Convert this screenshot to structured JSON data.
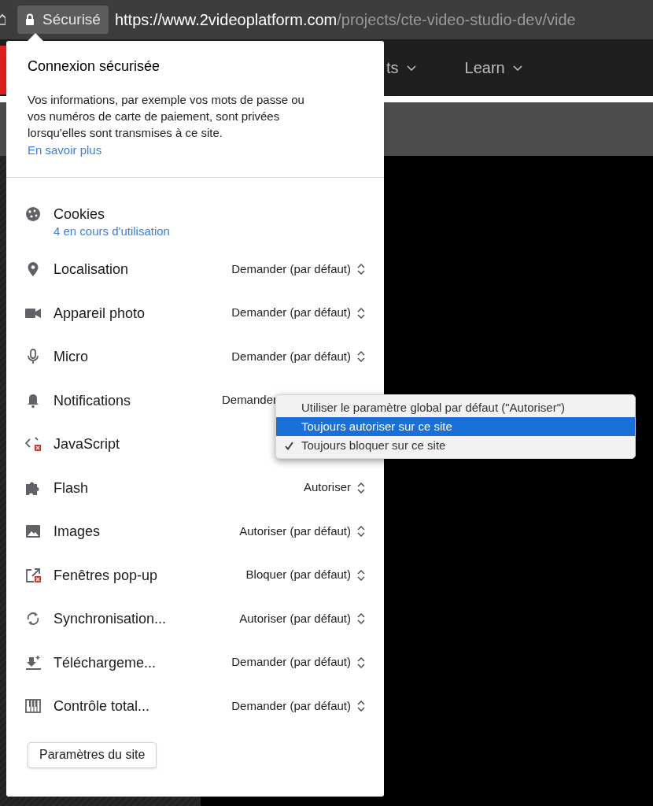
{
  "browser": {
    "security_chip": "Sécurisé",
    "url_host": "https://www.2videoplatform.com",
    "url_path": "/projects/cte-video-studio-dev/vide"
  },
  "page_nav": [
    {
      "label": "ts"
    },
    {
      "label": "Learn"
    }
  ],
  "popup": {
    "title": "Connexion sécurisée",
    "description": "Vos informations, par exemple vos mots de passe ou vos numéros de carte de paiement, sont privées lorsqu'elles sont transmises à ce site.",
    "learn_more": "En savoir plus",
    "permissions": [
      {
        "kind": "cookies",
        "label": "Cookies",
        "detail": "4 en cours d'utilisation"
      },
      {
        "kind": "location",
        "label": "Localisation",
        "value": "Demander (par défaut)"
      },
      {
        "kind": "camera",
        "label": "Appareil photo",
        "value": "Demander (par défaut)"
      },
      {
        "kind": "microphone",
        "label": "Micro",
        "value": "Demander (par défaut)"
      },
      {
        "kind": "notifications",
        "label": "Notifications",
        "value": "Demander",
        "menu_open": true
      },
      {
        "kind": "javascript",
        "label": "JavaScript"
      },
      {
        "kind": "flash",
        "label": "Flash",
        "value": "Autoriser"
      },
      {
        "kind": "images",
        "label": "Images",
        "value": "Autoriser (par défaut)"
      },
      {
        "kind": "popups",
        "label": "Fenêtres pop-up",
        "value": "Bloquer (par défaut)"
      },
      {
        "kind": "sync",
        "label": "Synchronisation...",
        "value": "Autoriser (par défaut)"
      },
      {
        "kind": "downloads",
        "label": "Téléchargeme...",
        "value": "Demander (par défaut)"
      },
      {
        "kind": "midi",
        "label": "Contrôle total...",
        "value": "Demander (par défaut)"
      }
    ],
    "site_settings_button": "Paramètres du site"
  },
  "dropdown": {
    "options": [
      {
        "label": "Utiliser le paramètre global par défaut (\"Autoriser\")",
        "selected": false,
        "checked": false
      },
      {
        "label": "Toujours autoriser sur ce site",
        "selected": true,
        "checked": false
      },
      {
        "label": "Toujours bloquer sur ce site",
        "selected": false,
        "checked": true
      }
    ]
  }
}
